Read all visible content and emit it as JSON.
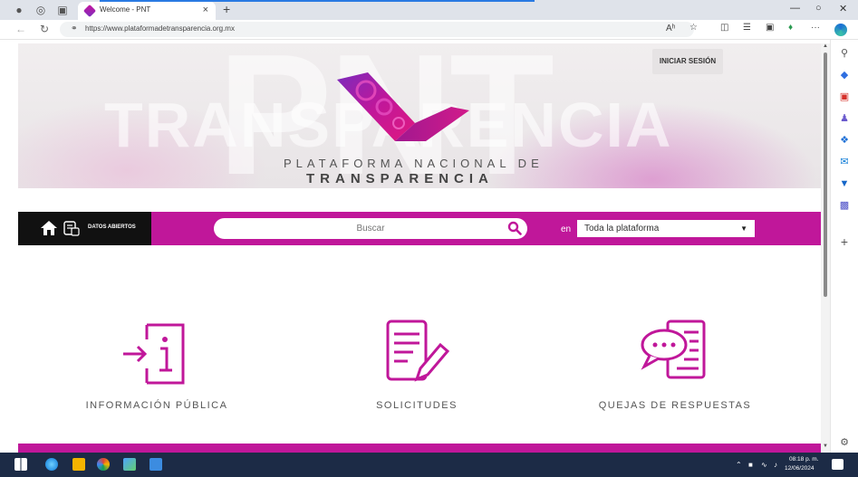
{
  "browser": {
    "tab_title": "Welcome - PNT",
    "new_tab": "+",
    "close_tab": "×",
    "url": "https://www.plataformadetransparencia.org.mx",
    "reader_mode": "Aʰ",
    "more": "···"
  },
  "hero": {
    "watermark_pnt": "PNT",
    "watermark_transparencia": "TRANSPARENCIA",
    "login_label": "INICIAR SESIÓN",
    "logo_line1": "PLATAFORMA NACIONAL DE",
    "logo_line2": "TRANSPARENCIA"
  },
  "searchbar": {
    "datos_abiertos": "DATOS ABIERTOS",
    "search_placeholder": "Buscar",
    "scope_label": "en",
    "scope_value": "Toda la plataforma"
  },
  "cards": [
    {
      "label": "INFORMACIÓN PÚBLICA",
      "icon": "information-icon"
    },
    {
      "label": "SOLICITUDES",
      "icon": "document-edit-icon"
    },
    {
      "label": "QUEJAS DE RESPUESTAS",
      "icon": "chat-document-icon"
    }
  ],
  "taskbar": {
    "time": "08:18 p. m.",
    "date": "12/06/2024"
  },
  "colors": {
    "brand_magenta": "#c0179a",
    "black_box": "#111111",
    "taskbar": "#1c2b46"
  }
}
